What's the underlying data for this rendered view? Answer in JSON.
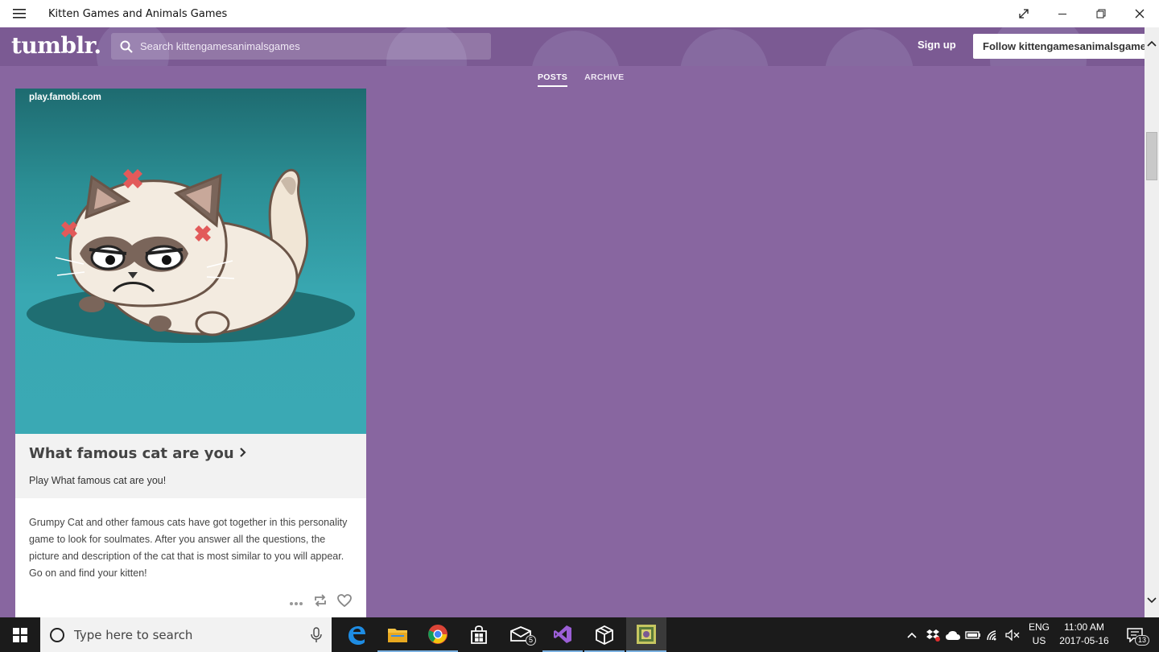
{
  "window": {
    "title": "Kitten Games and Animals Games"
  },
  "header": {
    "logo": "tumblr.",
    "search_placeholder": "Search kittengamesanimalsgames",
    "signup_label": "Sign up",
    "follow_label": "Follow kittengamesanimalsgames"
  },
  "tabs": [
    {
      "label": "POSTS",
      "active": true
    },
    {
      "label": "ARCHIVE",
      "active": false
    }
  ],
  "post": {
    "source": "play.famobi.com",
    "link_title": "What famous cat are you",
    "link_description": "Play What famous cat are you!",
    "body": "Grumpy Cat and other famous cats have got together in this personality game to look for soulmates. After you answer all the questions, the picture and description of the cat that is most similar to you will appear. Go on and find your kitten!"
  },
  "taskbar": {
    "search_placeholder": "Type here to search",
    "mail_badge": "5",
    "language_line1": "ENG",
    "language_line2": "US",
    "time": "11:00 AM",
    "date": "2017-05-16",
    "notification_badge": "13"
  },
  "colors": {
    "background": "#8866a0",
    "header": "#7b5a93",
    "image_top": "#1e6b70",
    "image_bottom": "#3aa9b4"
  }
}
